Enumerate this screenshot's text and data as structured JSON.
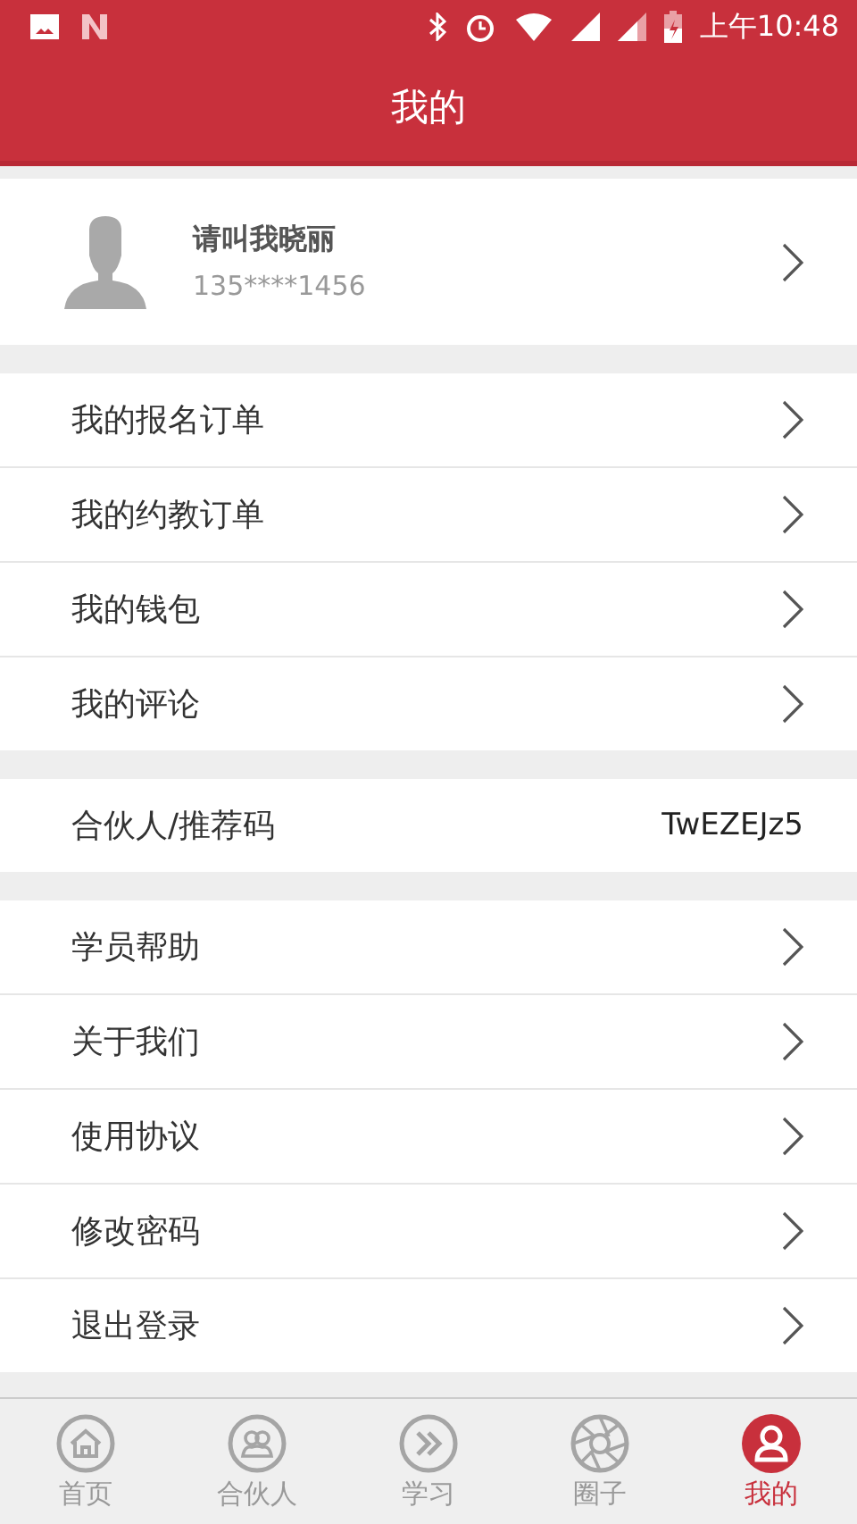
{
  "status_bar": {
    "time": "上午10:48"
  },
  "header": {
    "title": "我的"
  },
  "profile": {
    "name": "请叫我晓丽",
    "phone": "135****1456"
  },
  "groups": [
    {
      "rows": [
        {
          "kind": "link",
          "label": "我的报名订单"
        },
        {
          "kind": "link",
          "label": "我的约教订单"
        },
        {
          "kind": "link",
          "label": "我的钱包"
        },
        {
          "kind": "link",
          "label": "我的评论"
        }
      ]
    },
    {
      "rows": [
        {
          "kind": "value",
          "label": "合伙人/推荐码",
          "value": "TwEZEJz5"
        }
      ]
    },
    {
      "rows": [
        {
          "kind": "link",
          "label": "学员帮助"
        },
        {
          "kind": "link",
          "label": "关于我们"
        },
        {
          "kind": "link",
          "label": "使用协议"
        },
        {
          "kind": "link",
          "label": "修改密码"
        },
        {
          "kind": "link",
          "label": "退出登录"
        }
      ]
    }
  ],
  "tab_bar": [
    {
      "kind": "home",
      "label": "首页",
      "selected": false
    },
    {
      "kind": "partner",
      "label": "合伙人",
      "selected": false
    },
    {
      "kind": "study",
      "label": "学习",
      "selected": false
    },
    {
      "kind": "circle",
      "label": "圈子",
      "selected": false
    },
    {
      "kind": "me",
      "label": "我的",
      "selected": true
    }
  ]
}
